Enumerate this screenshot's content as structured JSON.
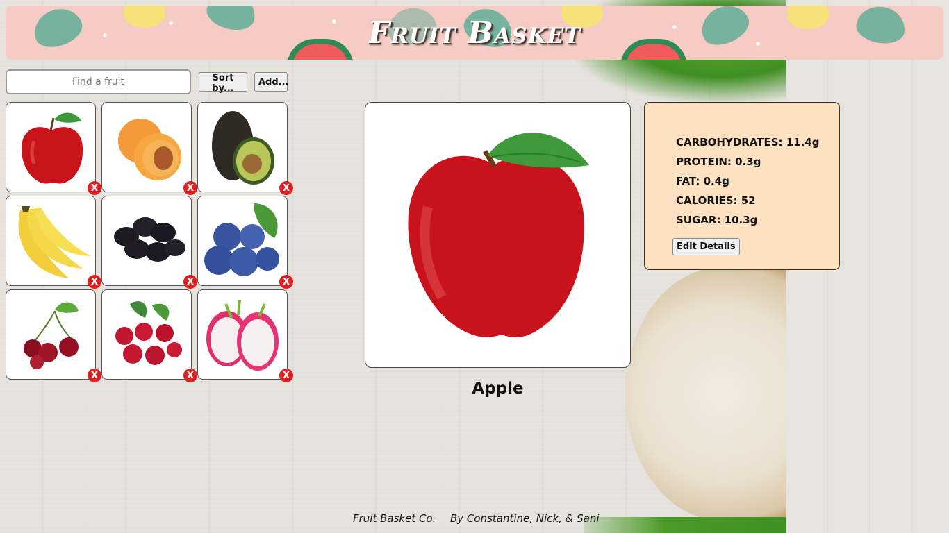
{
  "header": {
    "title": "Fruit Basket"
  },
  "toolbar": {
    "search_placeholder": "Find a fruit",
    "sort_label": "Sort by...",
    "add_label": "Add..."
  },
  "fruits": [
    {
      "name": "Apple",
      "icon": "apple-icon",
      "delete_label": "X"
    },
    {
      "name": "Apricot",
      "icon": "apricot-icon",
      "delete_label": "X"
    },
    {
      "name": "Avocado",
      "icon": "avocado-icon",
      "delete_label": "X"
    },
    {
      "name": "Banana",
      "icon": "banana-icon",
      "delete_label": "X"
    },
    {
      "name": "Blackberry",
      "icon": "blackberry-icon",
      "delete_label": "X"
    },
    {
      "name": "Blueberry",
      "icon": "blueberry-icon",
      "delete_label": "X"
    },
    {
      "name": "Cherry",
      "icon": "cherry-icon",
      "delete_label": "X"
    },
    {
      "name": "Cranberry",
      "icon": "cranberry-icon",
      "delete_label": "X"
    },
    {
      "name": "Dragonfruit",
      "icon": "dragonfruit-icon",
      "delete_label": "X"
    }
  ],
  "selected": {
    "name": "Apple",
    "nutrition": [
      "CARBOHYDRATES: 11.4g",
      "PROTEIN: 0.3g",
      "FAT: 0.4g",
      "CALORIES: 52",
      "SUGAR: 10.3g"
    ],
    "edit_label": "Edit Details"
  },
  "footer": {
    "company": "Fruit Basket Co.",
    "authors": "By Constantine, Nick, & Sani"
  },
  "colors": {
    "banner": "#f5cbc4",
    "nutrition_panel": "#fde1c1",
    "delete_button": "#e02020"
  }
}
